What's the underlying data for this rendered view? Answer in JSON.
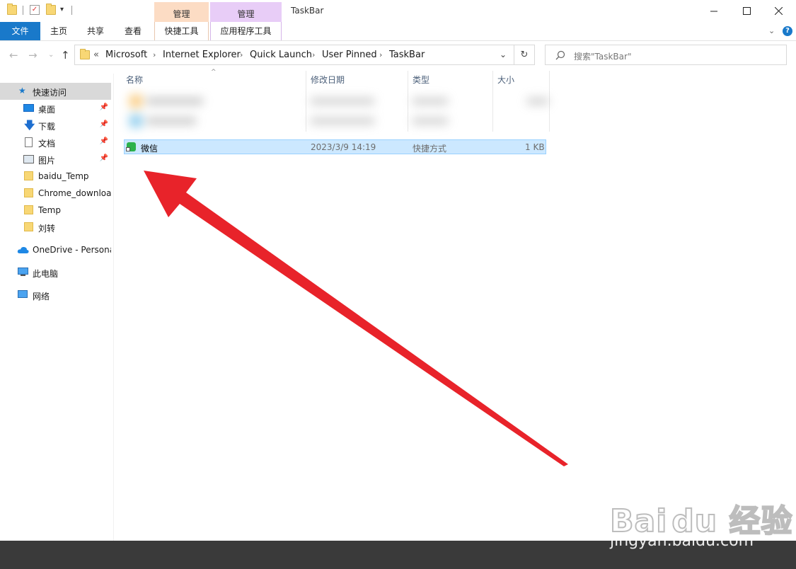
{
  "window": {
    "title": "TaskBar",
    "contextual_groups": [
      {
        "group": "管理",
        "tab": "快捷工具"
      },
      {
        "group": "管理",
        "tab": "应用程序工具"
      }
    ]
  },
  "ribbon": {
    "tabs": [
      "文件",
      "主页",
      "共享",
      "查看"
    ]
  },
  "address": {
    "overflow": "«",
    "crumbs": [
      "Microsoft",
      "Internet Explorer",
      "Quick Launch",
      "User Pinned",
      "TaskBar"
    ]
  },
  "search": {
    "placeholder": "搜索\"TaskBar\""
  },
  "nav": {
    "quick_access": "快速访问",
    "items": [
      {
        "label": "桌面",
        "pinned": true
      },
      {
        "label": "下载",
        "pinned": true
      },
      {
        "label": "文档",
        "pinned": true
      },
      {
        "label": "图片",
        "pinned": true
      },
      {
        "label": "baidu_Temp",
        "pinned": false
      },
      {
        "label": "Chrome_download",
        "pinned": false
      },
      {
        "label": "Temp",
        "pinned": false
      },
      {
        "label": "刘转",
        "pinned": false
      }
    ],
    "onedrive": "OneDrive - Persona",
    "this_pc": "此电脑",
    "network": "网络"
  },
  "columns": {
    "name": "名称",
    "date": "修改日期",
    "type": "类型",
    "size": "大小"
  },
  "files": [
    {
      "name": "微信",
      "date": "2023/3/9 14:19",
      "type": "快捷方式",
      "size": "1 KB"
    }
  ],
  "watermark": {
    "logo": "Bai du 经验",
    "url": "jingyan.baidu.com"
  },
  "colors": {
    "file_tab": "#1979ca",
    "selection": "#cce8ff",
    "arrow": "#e8232a"
  }
}
